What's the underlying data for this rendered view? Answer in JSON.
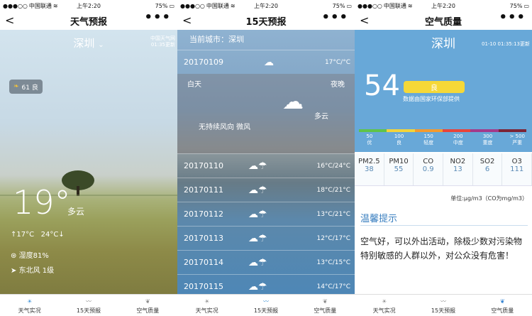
{
  "status": {
    "carrier": "中国联通",
    "time": "上午2:20",
    "battery": "75%"
  },
  "tabs": [
    {
      "label": "天气实况"
    },
    {
      "label": "15天预报"
    },
    {
      "label": "空气质量"
    }
  ],
  "screen1": {
    "title": "天气预报",
    "city": "深圳",
    "source_line1": "中国天气网",
    "source_line2": "01:35更新",
    "aqi_badge": "61 良",
    "temperature": "19°",
    "condition": "多云",
    "temp_low": "17°C",
    "temp_high": "24°C",
    "humidity": "湿度81%",
    "wind": "东北风 1级"
  },
  "screen2": {
    "title": "15天预报",
    "current_city": "当前城市：深圳",
    "today": {
      "date": "20170109",
      "range": "17°C/°C",
      "day_label": "白天",
      "night_label": "夜晚",
      "wind": "无持续风向 微风",
      "condition": "多云"
    },
    "days": [
      {
        "date": "20170110",
        "range": "16°C/24°C"
      },
      {
        "date": "20170111",
        "range": "18°C/21°C"
      },
      {
        "date": "20170112",
        "range": "13°C/21°C"
      },
      {
        "date": "20170113",
        "range": "12°C/17°C"
      },
      {
        "date": "20170114",
        "range": "13°C/15°C"
      },
      {
        "date": "20170115",
        "range": "14°C/17°C"
      }
    ]
  },
  "screen3": {
    "title": "空气质量",
    "city": "深圳",
    "update_time": "01-10 01:35:13更新",
    "aqi": "54",
    "level": "良",
    "source": "数据由国家环保部提供",
    "scale_colors": [
      "#5fc34a",
      "#f3d43a",
      "#f39a2e",
      "#e8443a",
      "#a33b8b",
      "#7b2436"
    ],
    "scale": [
      {
        "num": "50",
        "lbl": "优"
      },
      {
        "num": "100",
        "lbl": "良"
      },
      {
        "num": "150",
        "lbl": "轻度"
      },
      {
        "num": "200",
        "lbl": "中度"
      },
      {
        "num": "300",
        "lbl": "重度"
      },
      {
        "num": "> 500",
        "lbl": "严重"
      }
    ],
    "pollutants": [
      {
        "name": "PM2.5",
        "value": "38"
      },
      {
        "name": "PM10",
        "value": "55"
      },
      {
        "name": "CO",
        "value": "0.9"
      },
      {
        "name": "NO2",
        "value": "13"
      },
      {
        "name": "SO2",
        "value": "6"
      },
      {
        "name": "O3",
        "value": "111"
      }
    ],
    "unit": "单位:μg/m3（CO为mg/m3）",
    "tip_title": "温馨提示",
    "tip": "空气好，可以外出活动，除极少数对污染物特别敏感的人群以外，对公众没有危害！"
  }
}
